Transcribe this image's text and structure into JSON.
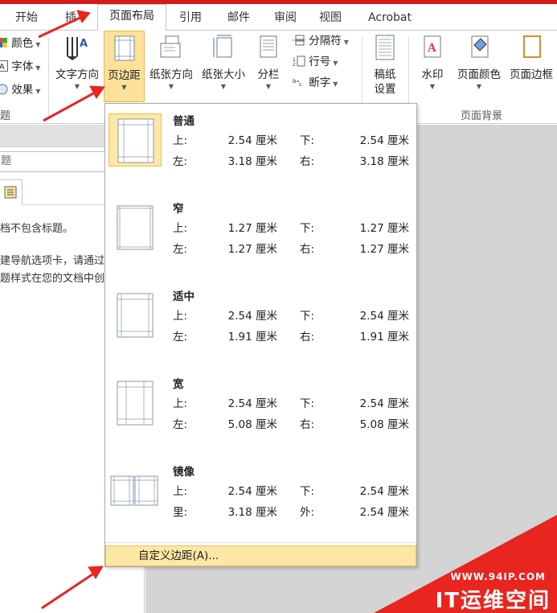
{
  "tabs": [
    {
      "label": "开始",
      "active": false
    },
    {
      "label": "插",
      "active": false
    },
    {
      "label": "页面布局",
      "active": true
    },
    {
      "label": "引用",
      "active": false
    },
    {
      "label": "邮件",
      "active": false
    },
    {
      "label": "审阅",
      "active": false
    },
    {
      "label": "视图",
      "active": false
    },
    {
      "label": "Acrobat",
      "active": false
    }
  ],
  "ribbon": {
    "theme_small": [
      "颜色",
      "字体",
      "效果"
    ],
    "theme_group_label": "题",
    "text_direction": "文字方向",
    "margins": "页边距",
    "orientation": "纸张方向",
    "size": "纸张大小",
    "columns": "分栏",
    "breaks": "分隔符",
    "line_numbers": "行号",
    "hyphenation": "断字",
    "draft_line1": "稿纸",
    "draft_line2": "设置",
    "watermark": "水印",
    "page_color": "页面颜色",
    "page_border": "页面边框",
    "page_bg_group": "页面背景"
  },
  "navpane": {
    "search_fragment": "题",
    "line1": "档不包含标题。",
    "line2": "建导航选项卡，请通过",
    "line3": "题样式在您的文档中创"
  },
  "margins_menu": {
    "options": [
      {
        "name": "普通",
        "k1": "上:",
        "v1": "2.54 厘米",
        "k2": "下:",
        "v2": "2.54 厘米",
        "k3": "左:",
        "v3": "3.18 厘米",
        "k4": "右:",
        "v4": "3.18 厘米",
        "selected": true
      },
      {
        "name": "窄",
        "k1": "上:",
        "v1": "1.27 厘米",
        "k2": "下:",
        "v2": "1.27 厘米",
        "k3": "左:",
        "v3": "1.27 厘米",
        "k4": "右:",
        "v4": "1.27 厘米",
        "selected": false
      },
      {
        "name": "适中",
        "k1": "上:",
        "v1": "2.54 厘米",
        "k2": "下:",
        "v2": "2.54 厘米",
        "k3": "左:",
        "v3": "1.91 厘米",
        "k4": "右:",
        "v4": "1.91 厘米",
        "selected": false
      },
      {
        "name": "宽",
        "k1": "上:",
        "v1": "2.54 厘米",
        "k2": "下:",
        "v2": "2.54 厘米",
        "k3": "左:",
        "v3": "5.08 厘米",
        "k4": "右:",
        "v4": "5.08 厘米",
        "selected": false
      },
      {
        "name": "镜像",
        "k1": "上:",
        "v1": "2.54 厘米",
        "k2": "下:",
        "v2": "2.54 厘米",
        "k3": "里:",
        "v3": "3.18 厘米",
        "k4": "外:",
        "v4": "2.54 厘米",
        "selected": false
      }
    ],
    "custom_label": "自定义边距(A)..."
  },
  "watermark": {
    "url": "WWW.94IP.COM",
    "brand": "IT运维空间"
  },
  "colors": {
    "accent_red": "#e8251f",
    "selected_fill": "#fbe19a",
    "selected_border": "#e6b945",
    "doc_grey": "#d4d4d4"
  }
}
